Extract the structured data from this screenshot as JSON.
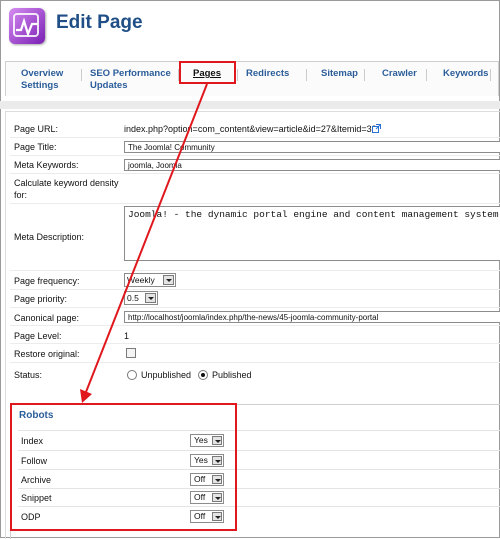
{
  "header": {
    "title": "Edit Page",
    "logo_icon": "joomla-seo-logo-icon"
  },
  "tabs": {
    "overview": "Overview",
    "settings": "Settings",
    "seo_performance": "SEO Performance",
    "updates": "Updates",
    "pages": "Pages",
    "redirects": "Redirects",
    "sitemap": "Sitemap",
    "crawler": "Crawler",
    "keywords": "Keywords"
  },
  "form": {
    "page_url": {
      "label": "Page URL:",
      "value": "index.php?option=com_content&view=article&id=27&Itemid=30"
    },
    "page_title": {
      "label": "Page Title:",
      "value": "The Joomla! Community"
    },
    "meta_keywords": {
      "label": "Meta Keywords:",
      "value": "joomla, Joomla"
    },
    "calc_density": {
      "label_line1": "Calculate keyword density",
      "label_line2": "for:"
    },
    "meta_description": {
      "label": "Meta Description:",
      "value": "Joomla! - the dynamic portal engine and content management system"
    },
    "page_frequency": {
      "label": "Page frequency:",
      "value": "Weekly"
    },
    "page_priority": {
      "label": "Page priority:",
      "value": "0.5"
    },
    "canonical": {
      "label": "Canonical page:",
      "value": "http://localhost/joomla/index.php/the-news/45-joomla-community-portal"
    },
    "page_level": {
      "label": "Page Level:",
      "value": "1"
    },
    "restore": {
      "label": "Restore original:",
      "checked": false
    },
    "status": {
      "label": "Status:",
      "unpublished": "Unpublished",
      "published": "Published",
      "selected": "Published"
    }
  },
  "robots": {
    "title": "Robots",
    "rows": [
      {
        "label": "Index",
        "value": "Yes"
      },
      {
        "label": "Follow",
        "value": "Yes"
      },
      {
        "label": "Archive",
        "value": "Off"
      },
      {
        "label": "Snippet",
        "value": "Off"
      },
      {
        "label": "ODP",
        "value": "Off"
      }
    ]
  },
  "colors": {
    "highlight": "#e0181e",
    "tab_text": "#2a5d9a",
    "title": "#1f4f86",
    "logo": "#9b3fd0"
  }
}
